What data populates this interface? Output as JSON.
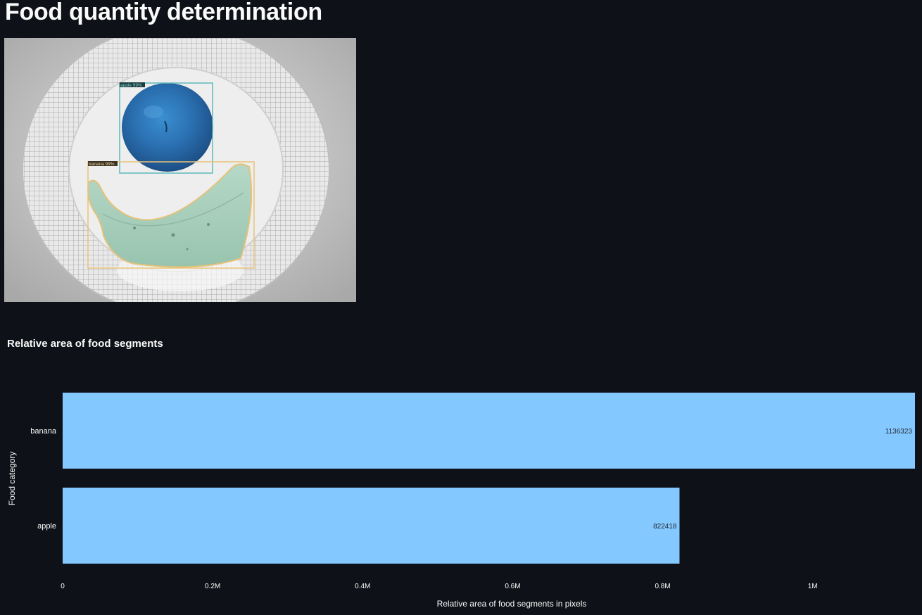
{
  "page": {
    "title": "Food quantity determination"
  },
  "image": {
    "detections": [
      {
        "label": "apple 99%",
        "color": "#5fb8b8"
      },
      {
        "label": "banana 99%",
        "color": "#e8c37a"
      }
    ]
  },
  "chart_data": {
    "type": "bar",
    "orientation": "horizontal",
    "title": "Relative area of food segments",
    "xlabel": "Relative area of food segments in pixels",
    "ylabel": "Food category",
    "categories": [
      "banana",
      "apple"
    ],
    "values": [
      1136323,
      822418
    ],
    "value_labels": [
      "1136323",
      "822418"
    ],
    "xlim": [
      0,
      1136323
    ],
    "xticks": [
      0,
      200000,
      400000,
      600000,
      800000,
      1000000
    ],
    "xtick_labels": [
      "0",
      "0.2M",
      "0.4M",
      "0.6M",
      "0.8M",
      "1M"
    ],
    "bar_color": "#83c9ff",
    "grid": false,
    "legend": "none"
  }
}
